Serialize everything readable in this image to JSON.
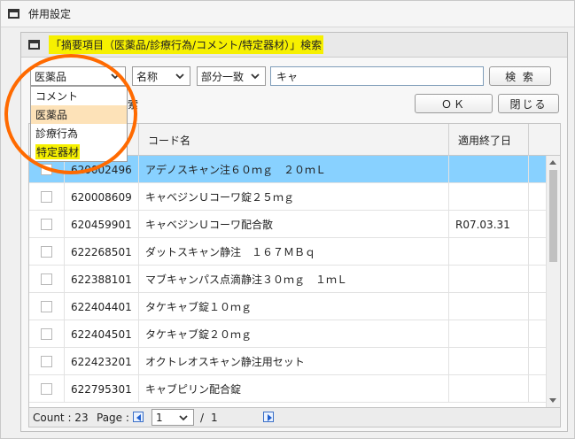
{
  "outer": {
    "title": "併用設定"
  },
  "dialog": {
    "title": "「摘要項目（医薬品/診療行為/コメント/特定器材）」検索"
  },
  "search": {
    "category_selected": "医薬品",
    "field_selected": "名称",
    "match_selected": "部分一致",
    "query": "キャ",
    "search_button": "検 索",
    "ok_button": "ＯＫ",
    "close_button": "閉じる",
    "partial_text": "索"
  },
  "dropdown": {
    "options": [
      "コメント",
      "医薬品",
      "診療行為",
      "特定器材"
    ]
  },
  "grid": {
    "columns": [
      "コード名",
      "適用終了日"
    ],
    "rows": [
      {
        "code": "620002496",
        "name": "アデノスキャン注６０ｍｇ　２０ｍＬ",
        "end": ""
      },
      {
        "code": "620008609",
        "name": "キャベジンＵコーワ錠２５ｍｇ",
        "end": ""
      },
      {
        "code": "620459901",
        "name": "キャベジンＵコーワ配合散",
        "end": "R07.03.31"
      },
      {
        "code": "622268501",
        "name": "ダットスキャン静注　１６７ＭＢｑ",
        "end": ""
      },
      {
        "code": "622388101",
        "name": "マブキャンパス点滴静注３０ｍｇ　１ｍＬ",
        "end": ""
      },
      {
        "code": "622404401",
        "name": "タケキャブ錠１０ｍｇ",
        "end": ""
      },
      {
        "code": "622404501",
        "name": "タケキャブ錠２０ｍｇ",
        "end": ""
      },
      {
        "code": "622423201",
        "name": "オクトレオスキャン静注用セット",
        "end": ""
      },
      {
        "code": "622795301",
        "name": "キャブピリン配合錠",
        "end": ""
      }
    ]
  },
  "footer": {
    "count": "Count : 23",
    "page_label": "Page :",
    "page_value": "1",
    "separator": "/",
    "total_pages": "1"
  }
}
